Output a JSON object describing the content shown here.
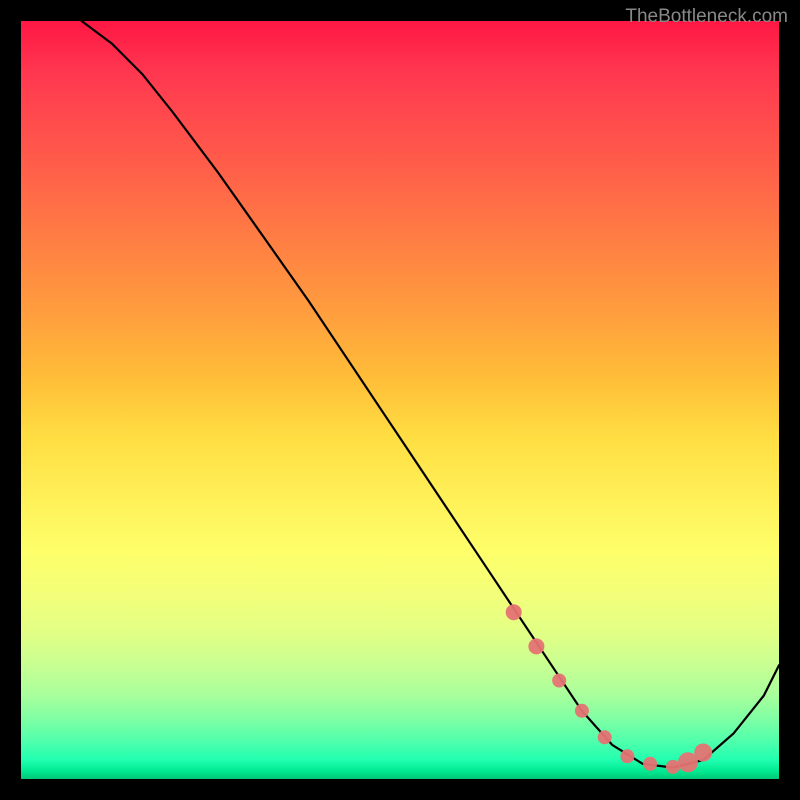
{
  "attribution": "TheBottleneck.com",
  "chart_data": {
    "type": "line",
    "title": "",
    "xlabel": "",
    "ylabel": "",
    "xlim": [
      0,
      100
    ],
    "ylim": [
      0,
      100
    ],
    "series": [
      {
        "name": "curve",
        "x": [
          8,
          12,
          16,
          20,
          26,
          32,
          38,
          44,
          50,
          56,
          62,
          66,
          70,
          74,
          78,
          82,
          86,
          90,
          94,
          98,
          100
        ],
        "y": [
          100,
          97,
          93,
          88,
          80,
          71.5,
          63,
          54,
          45,
          36,
          27,
          21,
          15,
          9,
          4.5,
          2,
          1.5,
          2.5,
          6,
          11,
          15
        ]
      }
    ],
    "markers": {
      "x": [
        65,
        68,
        71,
        74,
        77,
        80,
        83,
        86,
        88,
        90
      ],
      "y": [
        22,
        17.5,
        13,
        9,
        5.5,
        3,
        2,
        1.6,
        2.2,
        3.5
      ],
      "color": "#e57373",
      "size_pattern": [
        8,
        8,
        7,
        7,
        7,
        7,
        7,
        7,
        10,
        9
      ]
    },
    "background": {
      "type": "vertical-gradient",
      "colors": [
        "#ff1744",
        "#ff8c3c",
        "#ffe646",
        "#d8ff8a",
        "#00e890"
      ]
    }
  }
}
